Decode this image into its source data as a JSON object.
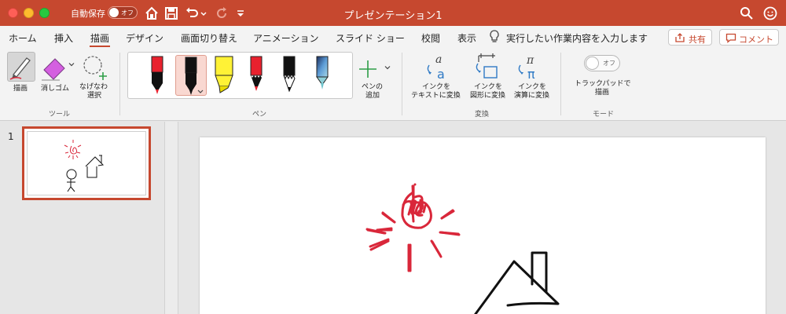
{
  "window": {
    "title": "プレゼンテーション1",
    "autosave_label": "自動保存",
    "autosave_state": "オフ"
  },
  "tabs": [
    {
      "label": "ホーム"
    },
    {
      "label": "挿入"
    },
    {
      "label": "描画"
    },
    {
      "label": "デザイン"
    },
    {
      "label": "画面切り替え"
    },
    {
      "label": "アニメーション"
    },
    {
      "label": "スライド ショー"
    },
    {
      "label": "校閲"
    },
    {
      "label": "表示"
    }
  ],
  "tell_me": "実行したい作業内容を入力します",
  "share_label": "共有",
  "comment_label": "コメント",
  "ribbon": {
    "tools": {
      "group_label": "ツール",
      "draw_label": "描画",
      "eraser_label": "消しゴム",
      "lasso_label_1": "なげなわ",
      "lasso_label_2": "選択"
    },
    "pens": {
      "group_label": "ペン",
      "items": [
        {
          "color": "#e8212e",
          "kind": "pen"
        },
        {
          "color": "#111111",
          "kind": "pen"
        },
        {
          "color": "#fff236",
          "kind": "highlighter"
        },
        {
          "color": "#e8212e",
          "kind": "pencil"
        },
        {
          "color": "#111111",
          "kind": "pencil"
        },
        {
          "color": "#3f6fa8",
          "kind": "galaxy"
        }
      ],
      "add_label_1": "ペンの",
      "add_label_2": "追加"
    },
    "convert": {
      "group_label": "変換",
      "ink_to_text_1": "インクを",
      "ink_to_text_2": "テキストに変換",
      "ink_to_shape_1": "インクを",
      "ink_to_shape_2": "図形に変換",
      "ink_to_math_1": "インクを",
      "ink_to_math_2": "演算に変換"
    },
    "mode": {
      "group_label": "モード",
      "toggle_state": "オフ",
      "trackpad_label_1": "トラックパッドで",
      "trackpad_label_2": "描画"
    }
  },
  "slides": {
    "current_number": "1"
  },
  "colors": {
    "accent": "#c6482f",
    "ink_red": "#d9273a",
    "ink_black": "#111111"
  }
}
